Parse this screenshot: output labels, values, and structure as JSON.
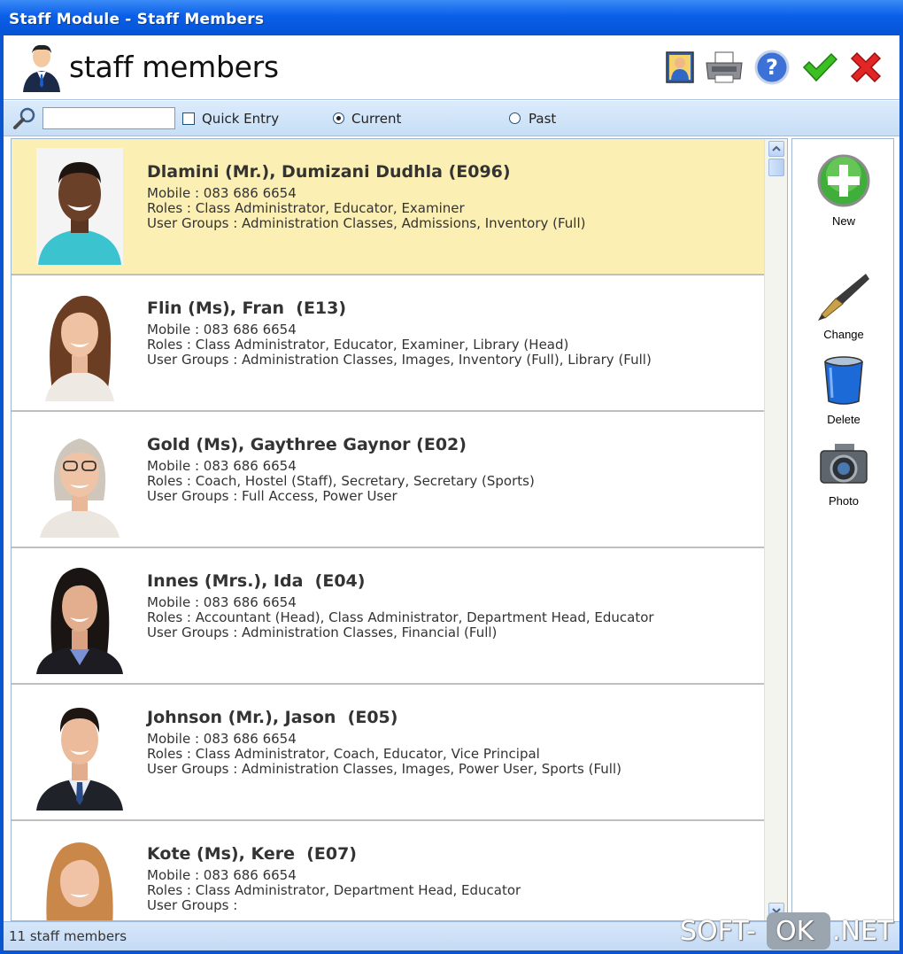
{
  "window": {
    "title": "Staff Module - Staff Members"
  },
  "header": {
    "title": "staff members"
  },
  "toolbar": {
    "icons": [
      "photo-view-icon",
      "printer-icon",
      "help-icon",
      "ok-check-icon",
      "cancel-x-icon"
    ]
  },
  "filter": {
    "search_value": "",
    "quick_entry_label": "Quick Entry",
    "quick_entry_checked": false,
    "current_label": "Current",
    "past_label": "Past",
    "selected": "current"
  },
  "staff": [
    {
      "name": "Dlamini (Mr.), Dumizani Dudhla (E096)",
      "mobile": "Mobile : 083 686 6654",
      "roles": "Roles : Class Administrator, Educator, Examiner",
      "groups": "User Groups : Administration Classes, Admissions, Inventory (Full)",
      "selected": true
    },
    {
      "name": "Flin (Ms), Fran  (E13)",
      "mobile": "Mobile : 083 686 6654",
      "roles": "Roles : Class Administrator, Educator, Examiner, Library (Head)",
      "groups": "User Groups : Administration Classes, Images, Inventory (Full), Library (Full)",
      "selected": false
    },
    {
      "name": "Gold (Ms), Gaythree Gaynor (E02)",
      "mobile": "Mobile : 083 686 6654",
      "roles": "Roles : Coach, Hostel (Staff), Secretary, Secretary (Sports)",
      "groups": "User Groups : Full Access, Power User",
      "selected": false
    },
    {
      "name": "Innes (Mrs.), Ida  (E04)",
      "mobile": "Mobile : 083 686 6654",
      "roles": "Roles : Accountant (Head), Class Administrator, Department Head, Educator",
      "groups": "User Groups : Administration Classes, Financial (Full)",
      "selected": false
    },
    {
      "name": "Johnson (Mr.), Jason  (E05)",
      "mobile": "Mobile : 083 686 6654",
      "roles": "Roles : Class Administrator, Coach, Educator, Vice Principal",
      "groups": "User Groups : Administration Classes, Images, Power User, Sports (Full)",
      "selected": false
    },
    {
      "name": "Kote (Ms), Kere  (E07)",
      "mobile": "Mobile : 083 686 6654",
      "roles": "Roles : Class Administrator, Department Head, Educator",
      "groups": "User Groups :",
      "selected": false
    }
  ],
  "sidebar": {
    "new_label": "New",
    "change_label": "Change",
    "delete_label": "Delete",
    "photo_label": "Photo"
  },
  "status": {
    "text": "11 staff members"
  },
  "watermark": {
    "part1": "SOFT-",
    "part2": "OK",
    "part3": ".NET"
  }
}
